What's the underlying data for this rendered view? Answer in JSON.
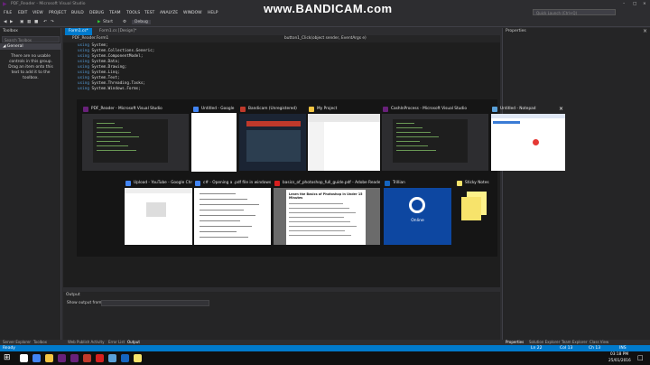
{
  "window": {
    "title": "PDF_Reader - Microsoft Visual Studio",
    "menu": [
      "FILE",
      "EDIT",
      "VIEW",
      "PROJECT",
      "BUILD",
      "DEBUG",
      "TEAM",
      "TOOLS",
      "TEST",
      "ANALYZE",
      "WINDOW",
      "HELP"
    ],
    "quick_launch_placeholder": "Quick Launch (Ctrl+Q)",
    "toolbar_start": "Start",
    "toolbar_config": "Debug"
  },
  "toolbox": {
    "title": "Toolbox",
    "search_placeholder": "Search Toolbox",
    "group": "General",
    "empty_message": "There are no usable controls in this group. Drag an item onto this text to add it to the toolbox."
  },
  "editor": {
    "tabs": [
      "Form1.cs*",
      "Form1.cs [Design]*"
    ],
    "project_dropdown": "PDF_Reader.Form1",
    "member_dropdown": "button1_Click(object sender, EventArgs e)",
    "code_lines": [
      {
        "kw": "using",
        "rest": " System;"
      },
      {
        "kw": "using",
        "rest": " System.Collections.Generic;"
      },
      {
        "kw": "using",
        "rest": " System.ComponentModel;"
      },
      {
        "kw": "using",
        "rest": " System.Data;"
      },
      {
        "kw": "using",
        "rest": " System.Drawing;"
      },
      {
        "kw": "using",
        "rest": " System.Linq;"
      },
      {
        "kw": "using",
        "rest": " System.Text;"
      },
      {
        "kw": "using",
        "rest": " System.Threading.Tasks;"
      },
      {
        "kw": "using",
        "rest": " System.Windows.Forms;"
      }
    ]
  },
  "properties": {
    "title": "Properties"
  },
  "output": {
    "title": "Output",
    "show_from_label": "Show output from:"
  },
  "bottom_tabs": [
    "Server Explorer",
    "Toolbox",
    "Web Publish Activity",
    "Error List",
    "Output",
    "Properties",
    "Solution Explorer",
    "Team Explorer",
    "Class View"
  ],
  "status": {
    "left": "Ready",
    "line": "Ln 22",
    "col": "Col 13",
    "ch": "Ch 13",
    "mode": "INS"
  },
  "watermark": {
    "text": "www.BANDICAM.com"
  },
  "alt_tab": {
    "windows": [
      {
        "title": "PDF_Reader - Microsoft Visual Studio",
        "icon_color": "#68217a",
        "kind": "vs"
      },
      {
        "title": "Untitled - Google Chrome",
        "icon_color": "#4285f4",
        "kind": "blank",
        "selected": true
      },
      {
        "title": "Bandicam (Unregistered)",
        "icon_color": "#c0392b",
        "kind": "bandicam"
      },
      {
        "title": "My Project",
        "icon_color": "#f4c542",
        "kind": "explorer"
      },
      {
        "title": "CashInProcess - Microsoft Visual Studio",
        "icon_color": "#68217a",
        "kind": "vs"
      },
      {
        "title": "Untitled - Notepad",
        "icon_color": "#5aa0d8",
        "kind": "notepad",
        "closable": true
      },
      {
        "title": "Upload - YouTube - Google Chrome",
        "icon_color": "#4285f4",
        "kind": "youtube"
      },
      {
        "title": "c# - Opening a .pdf file in windows form",
        "icon_color": "#4285f4",
        "kind": "so"
      },
      {
        "title": "basics_of_photoshop_full_guide.pdf - Adobe Reader",
        "icon_color": "#d71f1f",
        "kind": "pdf"
      },
      {
        "title": "Trillian",
        "icon_color": "#1565c0",
        "kind": "trillian",
        "label": "Online"
      },
      {
        "title": "Sticky Notes",
        "icon_color": "#f7e36b",
        "kind": "sticky"
      }
    ],
    "pdf_heading": "Learn the Basics of Photoshop in Under 15 Minutes"
  },
  "taskbar": {
    "time": "03:18 PM",
    "date": "25/01/2016",
    "apps": [
      "#ffffff",
      "#4285f4",
      "#f4c542",
      "#68217a",
      "#68217a",
      "#c0392b",
      "#d71f1f",
      "#5aa0d8",
      "#1565c0",
      "#f7e36b"
    ]
  }
}
